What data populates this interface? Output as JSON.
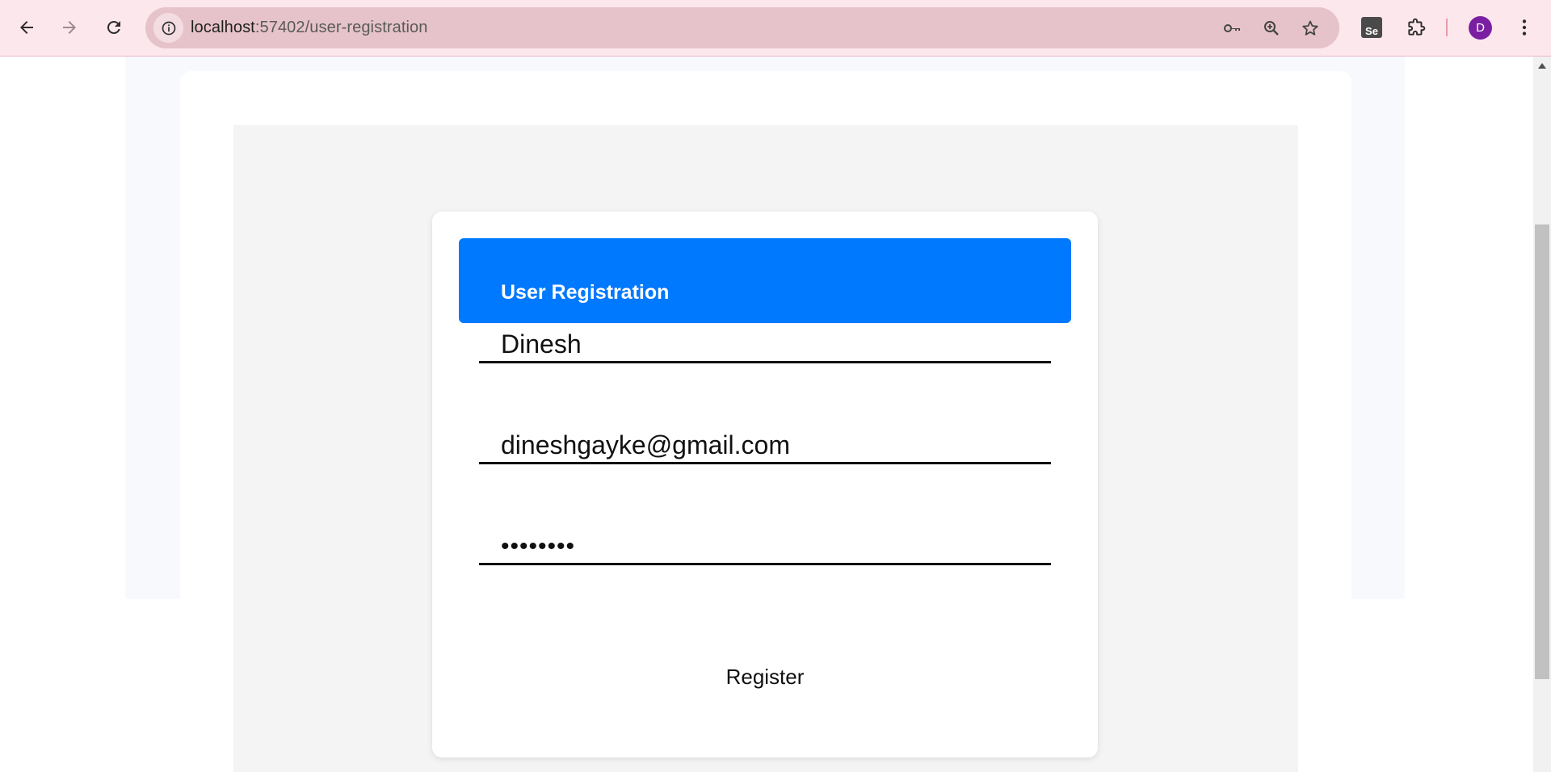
{
  "browser": {
    "url_host": "localhost",
    "url_rest": ":57402/user-registration",
    "extension_label": "Se",
    "profile_initial": "D",
    "profile_color": "#7b1fa2"
  },
  "form": {
    "title": "User Registration",
    "header_color": "#0079fe",
    "name_value": "Dinesh",
    "email_value": "dineshgayke@gmail.com",
    "password_value": "password",
    "register_label": "Register"
  }
}
